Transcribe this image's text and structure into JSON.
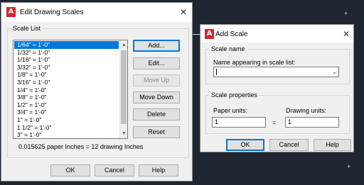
{
  "edit_dialog": {
    "title": "Edit Drawing Scales",
    "group_label": "Scale List",
    "scales": [
      {
        "label": "1/64\" = 1'-0\"",
        "selected": true
      },
      {
        "label": "1/32\" = 1'-0\""
      },
      {
        "label": "1/16\" = 1'-0\""
      },
      {
        "label": "3/32\" = 1'-0\""
      },
      {
        "label": "1/8\" = 1'-0\""
      },
      {
        "label": "3/16\" = 1'-0\""
      },
      {
        "label": "1/4\" = 1'-0\""
      },
      {
        "label": "3/8\" = 1'-0\""
      },
      {
        "label": "1/2\" = 1'-0\""
      },
      {
        "label": "3/4\" = 1'-0\""
      },
      {
        "label": "1\" = 1'-0\""
      },
      {
        "label": "1 1/2\" = 1'-0\""
      },
      {
        "label": "3\" = 1'-0\""
      },
      {
        "label": "6\" = 1'-0\""
      }
    ],
    "buttons": {
      "add": "Add...",
      "edit": "Edit...",
      "move_up": "Move Up",
      "move_down": "Move Down",
      "delete": "Delete",
      "reset": "Reset"
    },
    "status": "0.015625 paper Inches = 12 drawing Inches",
    "footer": {
      "ok": "OK",
      "cancel": "Cancel",
      "help": "Help"
    }
  },
  "add_dialog": {
    "title": "Add Scale",
    "name_group": "Scale name",
    "name_label": "Name appearing in scale list:",
    "name_value": "",
    "props_group": "Scale properties",
    "paper_units_label": "Paper units:",
    "paper_units_value": "1",
    "drawing_units_label": "Drawing units:",
    "drawing_units_value": "1",
    "equals": "=",
    "footer": {
      "ok": "OK",
      "cancel": "Cancel",
      "help": "Help"
    }
  },
  "icons": {
    "app": "autocad-icon",
    "close": "close-icon"
  },
  "colors": {
    "selection": "#0078d7",
    "app_icon": "#d8232a",
    "backdrop": "#1e2630"
  }
}
